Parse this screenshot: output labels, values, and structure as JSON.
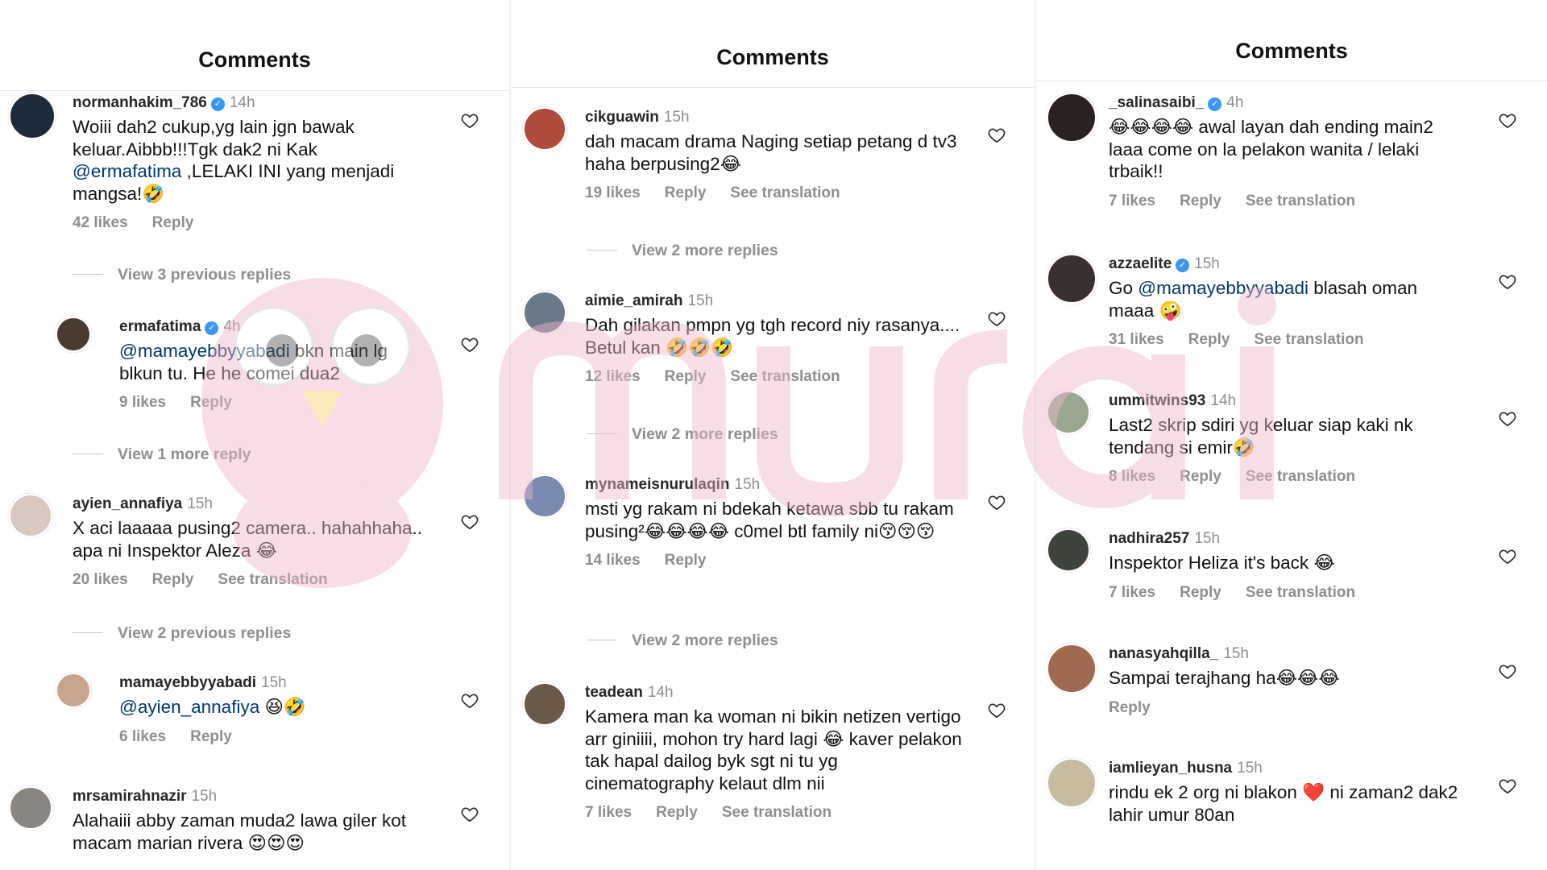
{
  "panels": [
    {
      "header": "Comments",
      "comments": [
        {
          "user": "normanhakim_786",
          "verified": true,
          "time": "14h",
          "text_parts": [
            {
              "t": "Woiii dah2 cukup,yg lain jgn bawak keluar.Aibbb!!!Tgk dak2 ni Kak "
            },
            {
              "t": "@ermafatima",
              "mention": true
            },
            {
              "t": " ,LELAKI INI yang menjadi mangsa!🤣"
            }
          ],
          "likes": "42 likes",
          "reply": "Reply",
          "translation": "",
          "avatar_color": "#1c2a3a"
        },
        {
          "view_more": "View 3 previous replies"
        },
        {
          "user": "ermafatima",
          "verified": true,
          "time": "4h",
          "text_parts": [
            {
              "t": "@mamayebbyyabadi",
              "mention": true
            },
            {
              "t": " bkn main lg blkun tu. He he comei dua2"
            }
          ],
          "likes": "9 likes",
          "reply": "Reply",
          "translation": "",
          "avatar_color": "#4a3a30",
          "indent": true
        },
        {
          "view_more": "View 1 more reply"
        },
        {
          "user": "ayien_annafiya",
          "verified": false,
          "time": "15h",
          "text_parts": [
            {
              "t": "X aci laaaaa pusing2 camera.. hahahhaha.. apa ni Inspektor Aleza 😂"
            }
          ],
          "likes": "20 likes",
          "reply": "Reply",
          "translation": "See translation",
          "avatar_color": "#d9c8c0"
        },
        {
          "view_more": "View 2 previous replies"
        },
        {
          "user": "mamayebbyyabadi",
          "verified": false,
          "time": "15h",
          "text_parts": [
            {
              "t": "@ayien_annafiya",
              "mention": true
            },
            {
              "t": " 😆🤣"
            }
          ],
          "likes": "6 likes",
          "reply": "Reply",
          "translation": "",
          "avatar_color": "#c9a58e",
          "indent": true
        },
        {
          "user": "mrsamirahnazir",
          "verified": false,
          "time": "15h",
          "text_parts": [
            {
              "t": "Alahaiii abby zaman muda2 lawa giler kot macam marian rivera 😍😍😍"
            }
          ],
          "likes": "",
          "reply": "",
          "translation": "",
          "avatar_color": "#8a8580"
        }
      ]
    },
    {
      "header": "Comments",
      "comments": [
        {
          "user": "cikguawin",
          "verified": false,
          "time": "15h",
          "text_parts": [
            {
              "t": "dah macam drama Naging setiap petang d tv3 haha berpusing2😂"
            }
          ],
          "likes": "19 likes",
          "reply": "Reply",
          "translation": "See translation",
          "avatar_color": "#b04a3a"
        },
        {
          "view_more": "View 2 more replies"
        },
        {
          "user": "aimie_amirah",
          "verified": false,
          "time": "15h",
          "text_parts": [
            {
              "t": "Dah gilakan pmpn yg tgh record niy rasanya.... Betul kan 🤣🤣🤣"
            }
          ],
          "likes": "12 likes",
          "reply": "Reply",
          "translation": "See translation",
          "avatar_color": "#6a7a8a"
        },
        {
          "view_more": "View 2 more replies"
        },
        {
          "user": "mynameisnurulaqin",
          "verified": false,
          "time": "15h",
          "text_parts": [
            {
              "t": "msti yg rakam ni bdekah ketawa sbb tu rakam pusing²😂😂😂😂 c0mel btl family ni😚😚😚"
            }
          ],
          "likes": "14 likes",
          "reply": "Reply",
          "translation": "",
          "avatar_color": "#7a8ab0"
        },
        {
          "view_more": "View 2 more replies"
        },
        {
          "user": "teadean",
          "verified": false,
          "time": "14h",
          "text_parts": [
            {
              "t": "Kamera man ka woman ni bikin netizen vertigo arr giniiii, mohon try hard lagi 😂 kaver pelakon tak hapal dailog byk sgt ni tu yg cinematography kelaut dlm nii"
            }
          ],
          "likes": "7 likes",
          "reply": "Reply",
          "translation": "See translation",
          "avatar_color": "#6b5a4a"
        }
      ]
    },
    {
      "header": "Comments",
      "comments": [
        {
          "user": "_salinasaibi_",
          "verified": true,
          "time": "4h",
          "text_parts": [
            {
              "t": "😂😂😂😂 awal layan dah ending main2 laaa come on la pelakon wanita / lelaki trbaik!!"
            }
          ],
          "likes": "7 likes",
          "reply": "Reply",
          "translation": "See translation",
          "avatar_color": "#2a2220"
        },
        {
          "user": "azzaelite",
          "verified": true,
          "time": "15h",
          "text_parts": [
            {
              "t": "Go "
            },
            {
              "t": "@mamayebbyyabadi",
              "mention": true
            },
            {
              "t": " blasah oman maaa 🤪"
            }
          ],
          "likes": "31 likes",
          "reply": "Reply",
          "translation": "See translation",
          "avatar_color": "#3a3030"
        },
        {
          "user": "ummitwins93",
          "verified": false,
          "time": "14h",
          "text_parts": [
            {
              "t": "Last2 skrip sdiri yg keluar siap kaki nk tendang si emir🤣"
            }
          ],
          "likes": "8 likes",
          "reply": "Reply",
          "translation": "See translation",
          "avatar_color": "#9aa890"
        },
        {
          "user": "nadhira257",
          "verified": false,
          "time": "15h",
          "text_parts": [
            {
              "t": "Inspektor Heliza it's back 😂"
            }
          ],
          "likes": "7 likes",
          "reply": "Reply",
          "translation": "See translation",
          "avatar_color": "#3e443c"
        },
        {
          "user": "nanasyahqilla_",
          "verified": false,
          "time": "15h",
          "text_parts": [
            {
              "t": "Sampai terajhang ha😂😂😂"
            }
          ],
          "likes": "",
          "reply": "Reply",
          "translation": "",
          "avatar_color": "#a06a50"
        },
        {
          "user": "iamlieyan_husna",
          "verified": false,
          "time": "15h",
          "text_parts": [
            {
              "t": "rindu ek 2 org ni blakon ❤️ ni zaman2 dak2 lahir umur 80an"
            }
          ],
          "likes": "",
          "reply": "",
          "translation": "",
          "avatar_color": "#c8bca0"
        }
      ]
    }
  ],
  "colors": {
    "username": "#262626",
    "meta": "#8e8e8e",
    "mention": "#00376b",
    "verified": "#3897f0",
    "watermark": "#e8b6c8"
  }
}
